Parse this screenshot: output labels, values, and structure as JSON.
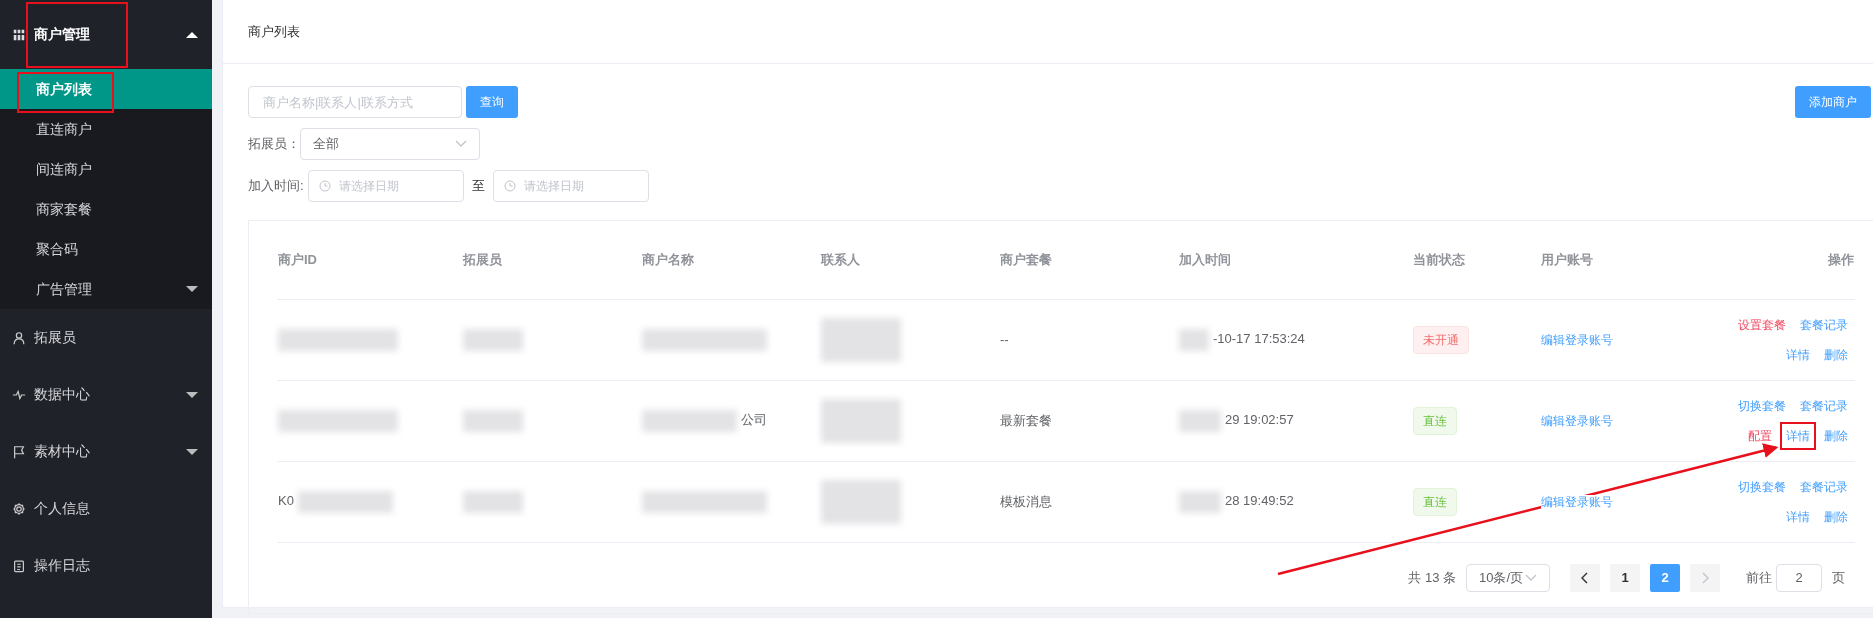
{
  "sidebar": {
    "groups": [
      {
        "label": "商户管理",
        "expanded": true,
        "highlighted": true,
        "children": [
          {
            "label": "商户列表",
            "selected": true,
            "highlighted": true
          },
          {
            "label": "直连商户",
            "selected": false,
            "highlighted": false
          },
          {
            "label": "间连商户",
            "selected": false,
            "highlighted": false
          },
          {
            "label": "商家套餐",
            "selected": false,
            "highlighted": false
          },
          {
            "label": "聚合码",
            "selected": false,
            "highlighted": false
          },
          {
            "label": "广告管理",
            "selected": false,
            "highlighted": false,
            "expanded": false
          }
        ]
      },
      {
        "label": "拓展员",
        "highlighted": false
      },
      {
        "label": "数据中心",
        "expanded": false,
        "highlighted": false
      },
      {
        "label": "素材中心",
        "expanded": false,
        "highlighted": false
      },
      {
        "label": "个人信息",
        "highlighted": false
      },
      {
        "label": "操作日志",
        "highlighted": false
      }
    ]
  },
  "page_title": "商户列表",
  "search": {
    "placeholder": "商户名称|联系人|联系方式",
    "button": "查询"
  },
  "add_button": "添加商户",
  "promoter_filter": {
    "label": "拓展员：",
    "value": "全部"
  },
  "date_filter": {
    "label": "加入时间:",
    "separator": "至",
    "start_placeholder": "请选择日期",
    "end_placeholder": "请选择日期"
  },
  "table": {
    "columns": [
      "商户ID",
      "拓展员",
      "商户名称",
      "联系人",
      "商户套餐",
      "加入时间",
      "当前状态",
      "用户账号",
      "操作"
    ],
    "rows": [
      {
        "id": {
          "blurred": true
        },
        "promoter": {
          "blurred": true
        },
        "name": {
          "blurred": true
        },
        "contact": {
          "blurred": true
        },
        "package": "--",
        "joined": {
          "text": "-10-17 17:53:24",
          "blurred": true
        },
        "status": {
          "text": "未开通",
          "kind": "danger"
        },
        "account": "编辑登录账号",
        "actions": [
          [
            {
              "label": "设置套餐",
              "kind": "danger",
              "highlighted": false
            },
            {
              "label": "套餐记录",
              "kind": "primary",
              "highlighted": false
            }
          ],
          [
            {
              "label": "详情",
              "kind": "primary",
              "highlighted": false
            },
            {
              "label": "删除",
              "kind": "primary",
              "highlighted": false
            }
          ]
        ]
      },
      {
        "id": {
          "blurred": true
        },
        "promoter": {
          "blurred": true
        },
        "name": {
          "text": "公司",
          "blurred": true
        },
        "contact": {
          "blurred": true
        },
        "package": "最新套餐",
        "joined": {
          "text": "29 19:02:57",
          "blurred": true
        },
        "status": {
          "text": "直连",
          "kind": "success"
        },
        "account": "编辑登录账号",
        "actions": [
          [
            {
              "label": "切换套餐",
              "kind": "primary",
              "highlighted": false
            },
            {
              "label": "套餐记录",
              "kind": "primary",
              "highlighted": false
            }
          ],
          [
            {
              "label": "配置",
              "kind": "danger",
              "highlighted": false
            },
            {
              "label": "详情",
              "kind": "primary",
              "highlighted": true
            },
            {
              "label": "删除",
              "kind": "primary",
              "highlighted": false
            }
          ]
        ]
      },
      {
        "id": {
          "text": "K0",
          "blurred": true
        },
        "promoter": {
          "blurred": true
        },
        "name": {
          "blurred": true
        },
        "contact": {
          "blurred": true
        },
        "package": "模板消息",
        "joined": {
          "text": "28 19:49:52",
          "blurred": true
        },
        "status": {
          "text": "直连",
          "kind": "success"
        },
        "account": "编辑登录账号",
        "actions": [
          [
            {
              "label": "切换套餐",
              "kind": "primary",
              "highlighted": false
            },
            {
              "label": "套餐记录",
              "kind": "primary",
              "highlighted": false
            }
          ],
          [
            {
              "label": "详情",
              "kind": "primary",
              "highlighted": false
            },
            {
              "label": "删除",
              "kind": "primary",
              "highlighted": false
            }
          ]
        ]
      }
    ]
  },
  "pagination": {
    "total": "共 13 条",
    "page_size": "10条/页",
    "pages": [
      {
        "label": "1",
        "selected": false
      },
      {
        "label": "2",
        "selected": true
      }
    ],
    "goto_label": "前往",
    "goto_value": "2",
    "page_suffix": "页",
    "prev_disabled": false,
    "next_disabled": true
  },
  "annotation_arrow": true
}
